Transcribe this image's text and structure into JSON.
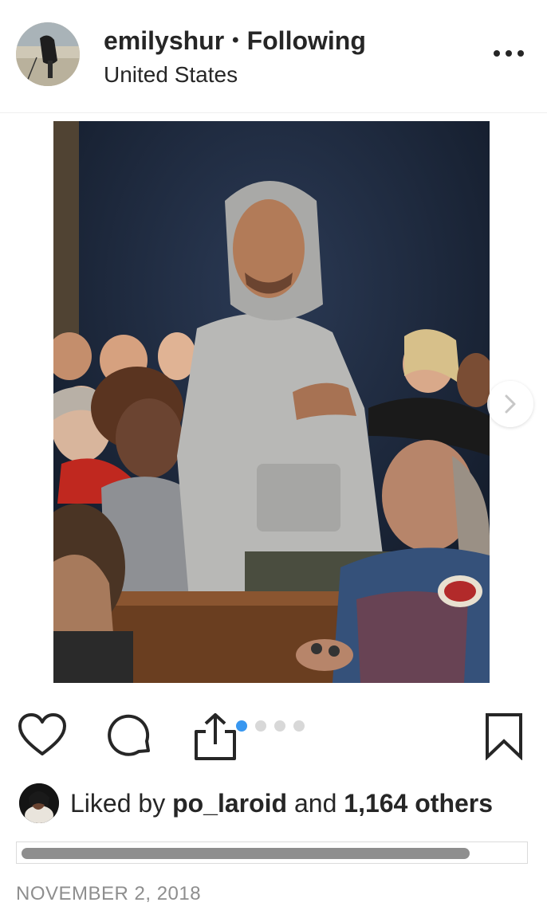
{
  "header": {
    "username": "emilyshur",
    "separator": "•",
    "follow_status": "Following",
    "location": "United States",
    "more_icon": "more-horizontal-icon"
  },
  "post": {
    "carousel": {
      "total_slides": 4,
      "active_slide": 1
    }
  },
  "actions": {
    "like_icon": "heart-icon",
    "comment_icon": "comment-icon",
    "share_icon": "share-icon",
    "save_icon": "bookmark-icon"
  },
  "likes": {
    "prefix": "Liked by",
    "user": "po_laroid",
    "conjunction": "and",
    "others": "1,164 others"
  },
  "timestamp": "NOVEMBER 2, 2018",
  "colors": {
    "text": "#262626",
    "muted": "#8e8e8e",
    "accent": "#3897f0",
    "divider": "#efefef"
  }
}
